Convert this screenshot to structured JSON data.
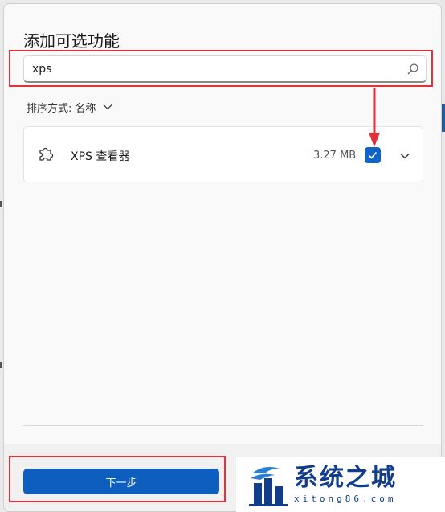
{
  "dialog": {
    "title": "添加可选功能"
  },
  "search": {
    "value": "xps",
    "icon": "search-icon"
  },
  "sort": {
    "label": "排序方式:",
    "value": "名称"
  },
  "features": [
    {
      "name": "XPS 查看器",
      "size": "3.27 MB",
      "checked": true,
      "icon": "puzzle-icon"
    }
  ],
  "footer": {
    "next_label": "下一步"
  },
  "watermark": {
    "title": "系统之城",
    "url": "xitong86.com"
  },
  "colors": {
    "accent": "#0e5ec0",
    "highlight": "#e3303a",
    "watermark": "#123d8a"
  }
}
